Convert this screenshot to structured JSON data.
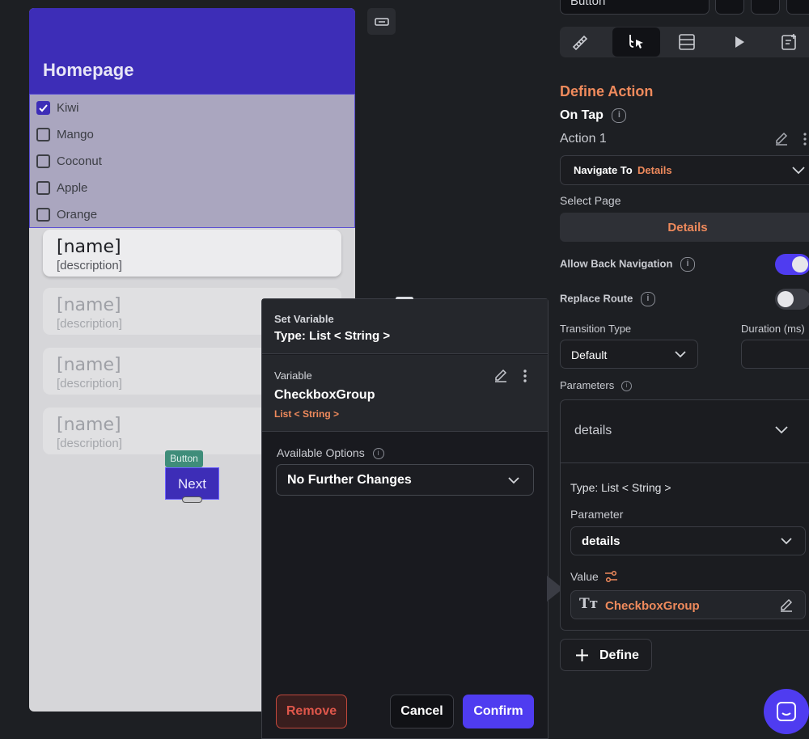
{
  "canvas": {
    "app_bar_title": "Homepage",
    "checkbox_options": [
      {
        "label": "Kiwi",
        "checked": true
      },
      {
        "label": "Mango",
        "checked": false
      },
      {
        "label": "Coconut",
        "checked": false
      },
      {
        "label": "Apple",
        "checked": false
      },
      {
        "label": "Orange",
        "checked": false
      }
    ],
    "cards": [
      {
        "name": "[name]",
        "description": "[description]"
      },
      {
        "name": "[name]",
        "description": "[description]"
      },
      {
        "name": "[name]",
        "description": "[description]"
      },
      {
        "name": "[name]",
        "description": "[description]"
      }
    ],
    "button_tag": "Button",
    "button_label": "Next"
  },
  "popup": {
    "header_label": "Set Variable",
    "header_type": "Type: List < String >",
    "variable_label": "Variable",
    "variable_name": "CheckboxGroup",
    "variable_type": "List < String >",
    "available_options_label": "Available Options",
    "available_options_value": "No Further Changes",
    "remove_label": "Remove",
    "cancel_label": "Cancel",
    "confirm_label": "Confirm"
  },
  "panel": {
    "widget_name": "Button",
    "section_title": "Define Action",
    "trigger": "On Tap",
    "action_label": "Action 1",
    "action_prefix": "Navigate To",
    "action_target": "Details",
    "select_page_label": "Select Page",
    "select_page_value": "Details",
    "allow_back_label": "Allow Back Navigation",
    "allow_back_on": true,
    "replace_route_label": "Replace Route",
    "replace_route_on": false,
    "transition_type_label": "Transition Type",
    "transition_type_value": "Default",
    "duration_label": "Duration (ms)",
    "parameters_label": "Parameters",
    "param_header": "details",
    "param_type": "Type: List < String >",
    "parameter_label": "Parameter",
    "parameter_value": "details",
    "value_label": "Value",
    "value_value": "CheckboxGroup",
    "define_label": "Define"
  },
  "colors": {
    "accent": "#4f3cf0",
    "app_bar": "#3d2db7",
    "highlight_orange": "#ef8a5c",
    "danger": "#e0574b"
  }
}
